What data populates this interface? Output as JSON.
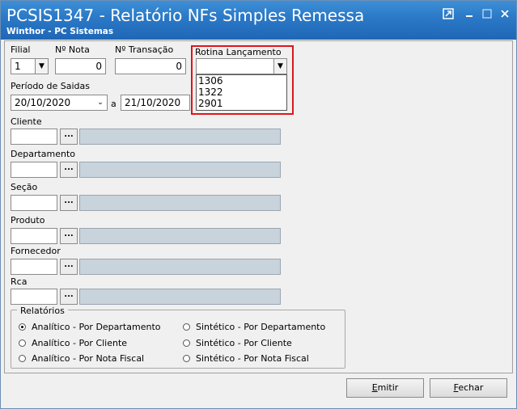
{
  "window": {
    "title": "PCSIS1347 - Relatório NFs Simples Remessa",
    "subtitle": "Winthor - PC Sistemas",
    "controls": [
      "pin-icon",
      "minimize-icon",
      "maximize-icon",
      "close-icon"
    ]
  },
  "form": {
    "filial": {
      "label": "Filial",
      "value": "1"
    },
    "nota": {
      "label": "Nº Nota",
      "value": "0"
    },
    "transacao": {
      "label": "Nº Transação",
      "value": "0"
    },
    "rotina": {
      "label": "Rotina Lançamento",
      "value": "",
      "options": [
        "1306",
        "1322",
        "2901"
      ]
    },
    "periodo": {
      "label": "Período de Saidas",
      "from": "20/10/2020",
      "separator": "a",
      "to": "21/10/2020"
    },
    "lookups": [
      {
        "label": "Cliente",
        "button": "..."
      },
      {
        "label": "Departamento",
        "button": "..."
      },
      {
        "label": "Seção",
        "button": "..."
      },
      {
        "label": "Produto",
        "button": "..."
      },
      {
        "label": "Fornecedor",
        "button": "..."
      },
      {
        "label": "Rca",
        "button": "..."
      }
    ]
  },
  "relatorios": {
    "label": "Relatórios",
    "selected": "Analítico - Por Departamento",
    "options_left": [
      "Analítico - Por Departamento",
      "Analítico - Por Cliente",
      "Analítico - Por Nota Fiscal"
    ],
    "options_right": [
      "Sintético - Por Departamento",
      "Sintético - Por Cliente",
      "Sintético - Por Nota Fiscal"
    ]
  },
  "footer": {
    "emitir": {
      "mnemonic": "E",
      "rest": "mitir"
    },
    "fechar": {
      "mnemonic": "F",
      "rest": "echar"
    }
  },
  "colors": {
    "titlebar": "#2a78c6",
    "highlight": "#e0141c",
    "readonly_field": "#c8d3dc"
  }
}
